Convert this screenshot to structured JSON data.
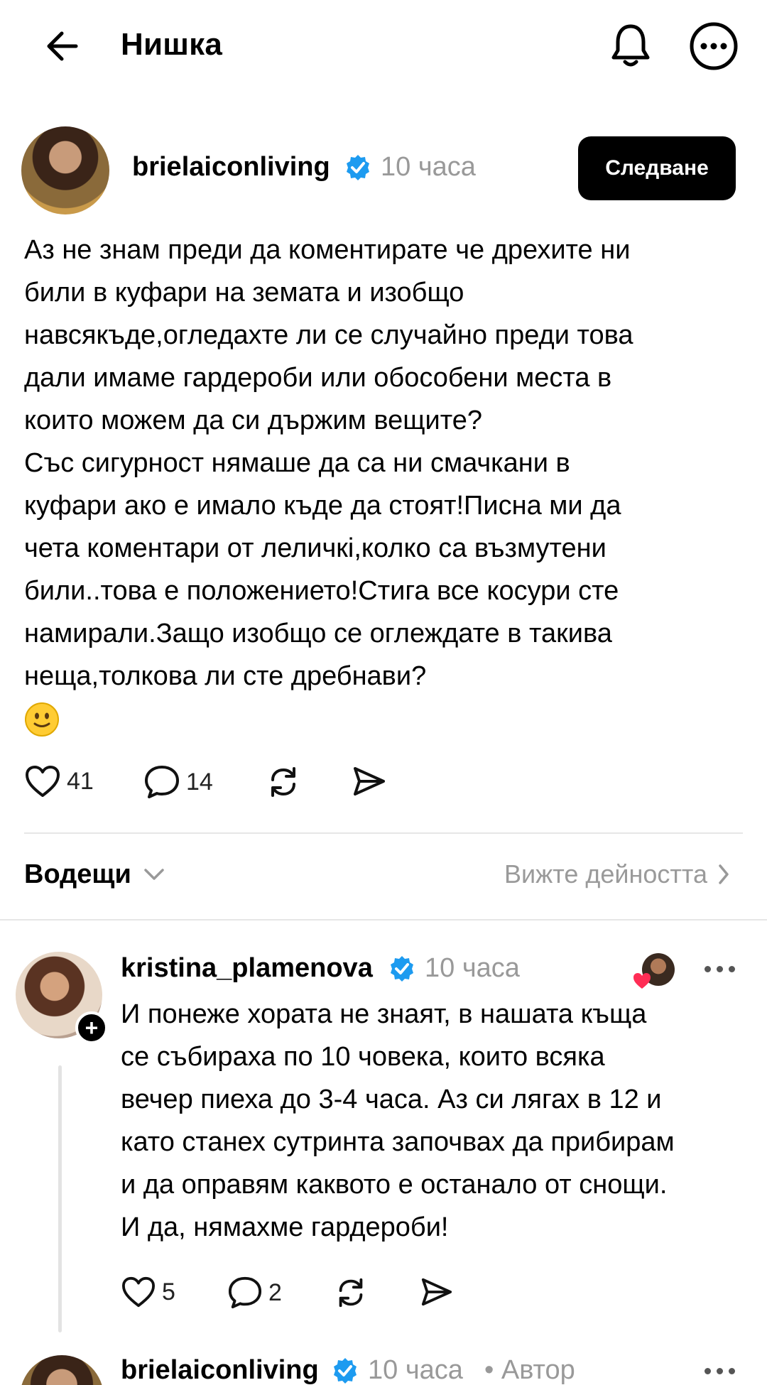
{
  "header": {
    "title": "Нишка"
  },
  "post": {
    "username": "brielaiconliving",
    "time": "10 часа",
    "follow_label": "Следване",
    "text": "Аз не знам преди да коментирате че дрехите ни\nбили в куфари на земата и изобщо\nнавсякъде,огледахте ли се случайно преди това\nдали имаме гардероби или обособени места в\nкоито можем да си държим вещите?\nСъс сигурност нямаше да са ни смачкани в\nкуфари ако е имало къде да стоят!Писна ми да\nчета коментари от леличкi,колко са възмутени\nбили..това е положението!Стига все косури сте\nнамирали.Защо изобщо се оглеждате в такива\nнеща,толкова ли сте дребнави?",
    "likes": "41",
    "comments": "14"
  },
  "sort": {
    "label": "Водещи",
    "activity_link": "Вижте дейността"
  },
  "reply": {
    "username": "kristina_plamenova",
    "time": "10 часа",
    "text": "И понеже хората не знаят, в нашата къща\nсе събираха по 10 човека, които всяка\nвечер пиеха до 3-4 часа. Аз си лягах в 12 и\nкато станех сутринта започвах да прибирам\nи да оправям каквото е останало от снощи.\nИ да, нямахме гардероби!",
    "likes": "5",
    "comments": "2"
  },
  "next_reply": {
    "username": "brielaiconliving",
    "time": "10 часа",
    "author_tag": "• Автор"
  },
  "colors": {
    "verified": "#1d9bf0",
    "muted": "#999999",
    "like_heart": "#ff2d55"
  }
}
